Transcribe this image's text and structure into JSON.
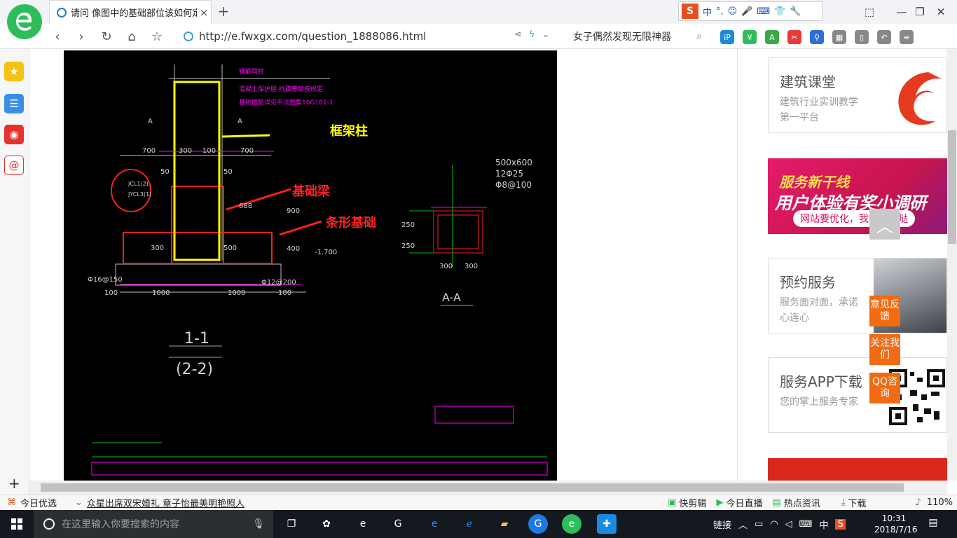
{
  "browser": {
    "tab_title": "请问 像图中的基础部位该如何定",
    "tab_close": "×",
    "new_tab": "+",
    "url": "http://e.fwxgx.com/question_1888086.html",
    "search_text": "女子偶然发现无限神器",
    "window_controls": [
      "⬚",
      "—",
      "❐",
      "✕"
    ]
  },
  "ime": {
    "logo": "S",
    "items": [
      "中",
      "°,",
      "☺",
      "🎤",
      "⌨",
      "👕",
      "🔧"
    ]
  },
  "cad": {
    "labels": {
      "kjz": "框架柱",
      "jcl": "基础梁",
      "txjc": "条形基础"
    },
    "dims": {
      "d700l": "700",
      "d300a": "300",
      "d100": "100",
      "d700r": "700",
      "d50l": "50",
      "d50r": "50",
      "a_l": "A",
      "a_r": "A",
      "d300b": "300",
      "d500": "500",
      "d1000l": "1000",
      "d1000r": "1000",
      "d100l": "100",
      "d100r": "100",
      "rebar_l": "Φ16@150",
      "rebar_r": "Φ12@200",
      "elev": "-1.700",
      "jcl2": "JCL1(2)",
      "jcl3": "JYCL3(1)",
      "sec1": "1-1",
      "sec2": "(2-2)",
      "size": "500x600",
      "bars": "12Φ25",
      "stirrup": "Φ8@100",
      "s250a": "250",
      "s250b": "250",
      "s300a": "300",
      "s300b": "300",
      "aa": "A-A",
      "v400": "400",
      "v900": "900",
      "v688": "688"
    },
    "notes": [
      "钢筋同柱",
      "混凝土保护层 抗震等级按规定",
      "基础插筋详见平法图集16G101-1"
    ]
  },
  "cards": [
    {
      "title": "建筑课堂",
      "sub": "建筑行业实训教学第一平台"
    },
    {
      "title": "预约服务",
      "sub": "服务面对面，承诺心连心"
    },
    {
      "title": "服务APP下载",
      "sub": "您的掌上服务专家"
    }
  ],
  "promo": {
    "line1": "服务新干线",
    "line2": "用户体验有奖小调研",
    "line3": "网站要优化，我们听你哒"
  },
  "float_buttons": [
    "意见反馈",
    "关注我们",
    "QQ咨询"
  ],
  "status": {
    "left1": "今日优选",
    "news": "众星出席双宋婚礼 章子怡最美明艳照人",
    "right": [
      "快剪辑",
      "今日直播",
      "热点资讯",
      "下载"
    ],
    "zoom": "110%"
  },
  "taskbar": {
    "search_placeholder": "在这里输入你要搜索的内容",
    "tray_text": "链接",
    "ime": "中",
    "time": "10:31",
    "date": "2018/7/16"
  },
  "colors": {
    "accent_green": "#2dbd5b",
    "cad_yellow": "#ffff00",
    "cad_red": "#ff2020",
    "orange": "#f26a12"
  }
}
